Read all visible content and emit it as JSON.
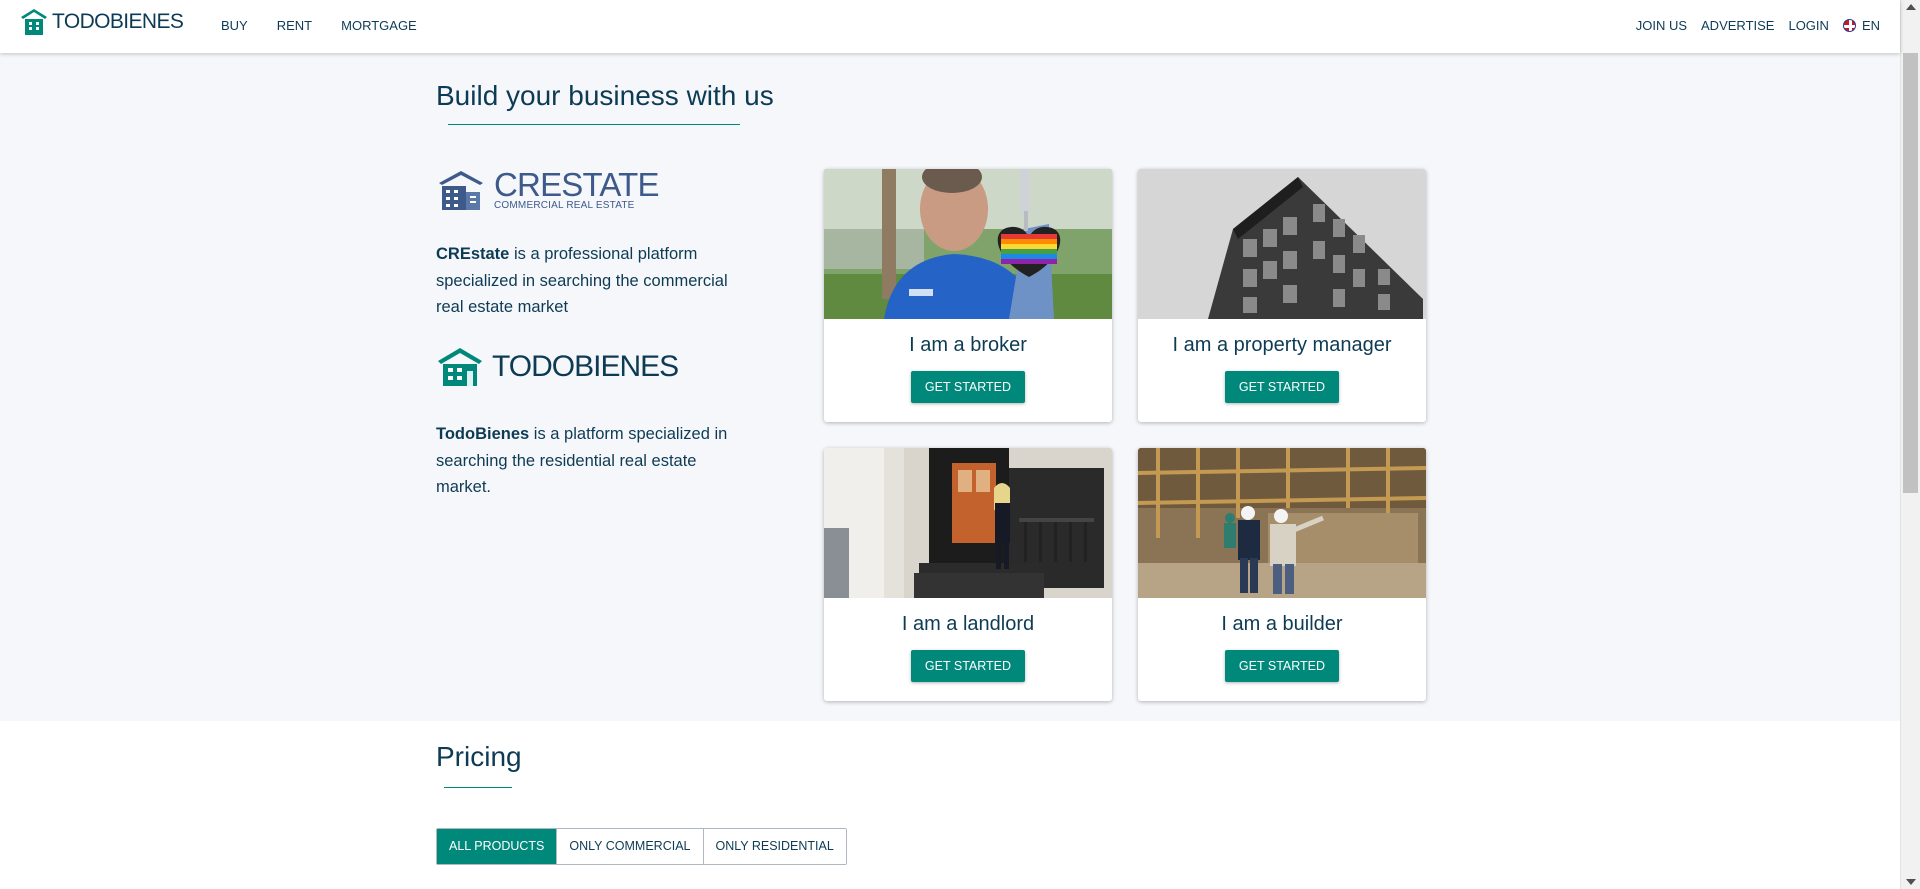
{
  "header": {
    "logo_text": "TODOBIENES",
    "nav_left": [
      "BUY",
      "RENT",
      "MORTGAGE"
    ],
    "nav_right": [
      "JOIN US",
      "ADVERTISE",
      "LOGIN"
    ],
    "language": "EN"
  },
  "business": {
    "title": "Build your business with us",
    "crestate": {
      "name": "CRESTATE",
      "subtitle": "COMMERCIAL REAL ESTATE",
      "desc_bold": "CREstate",
      "desc_rest": " is a professional platform specialized in searching the commercial real estate market"
    },
    "todobienes": {
      "name": "TODOBIENES",
      "desc_bold": "TodoBienes",
      "desc_rest": " is a platform specialized in searching the residential real estate market."
    },
    "cards": [
      {
        "title": "I am a broker",
        "button": "GET STARTED"
      },
      {
        "title": "I am a property manager",
        "button": "GET STARTED"
      },
      {
        "title": "I am a landlord",
        "button": "GET STARTED"
      },
      {
        "title": "I am a builder",
        "button": "GET STARTED"
      }
    ]
  },
  "pricing": {
    "title": "Pricing",
    "tabs": [
      "ALL PRODUCTS",
      "ONLY COMMERCIAL",
      "ONLY RESIDENTIAL"
    ],
    "active_tab": "ALL PRODUCTS"
  },
  "colors": {
    "accent": "#00897b",
    "text": "#0e3b54",
    "crestate_blue": "#3d5a8a"
  }
}
